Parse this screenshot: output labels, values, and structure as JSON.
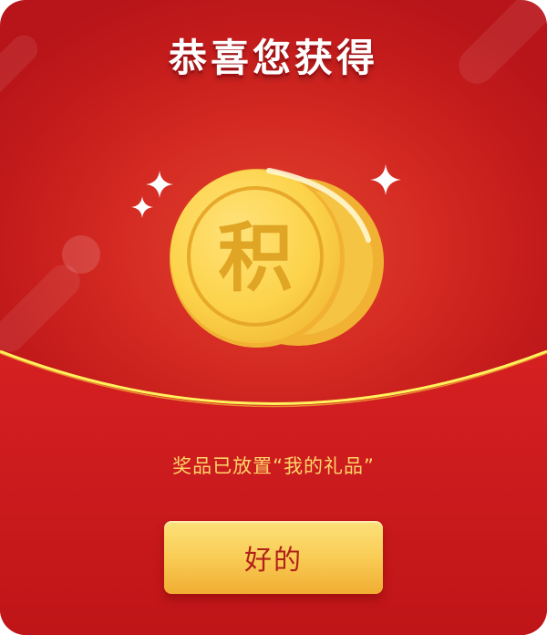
{
  "dialog": {
    "title": "恭喜您获得",
    "coin_character": "积",
    "message": "奖品已放置“我的礼品”",
    "confirm_label": "好的"
  },
  "colors": {
    "background_red": "#d42a22",
    "lower_red": "#c71a1d",
    "arc_yellow": "#fff25c",
    "coin_gold": "#fcd34a",
    "coin_text": "#e0a524",
    "message_yellow": "#ffd56a",
    "button_gold": "#f9cc55",
    "button_text": "#b1211a"
  },
  "icons": [
    "sparkle-icon",
    "coin-icon"
  ]
}
